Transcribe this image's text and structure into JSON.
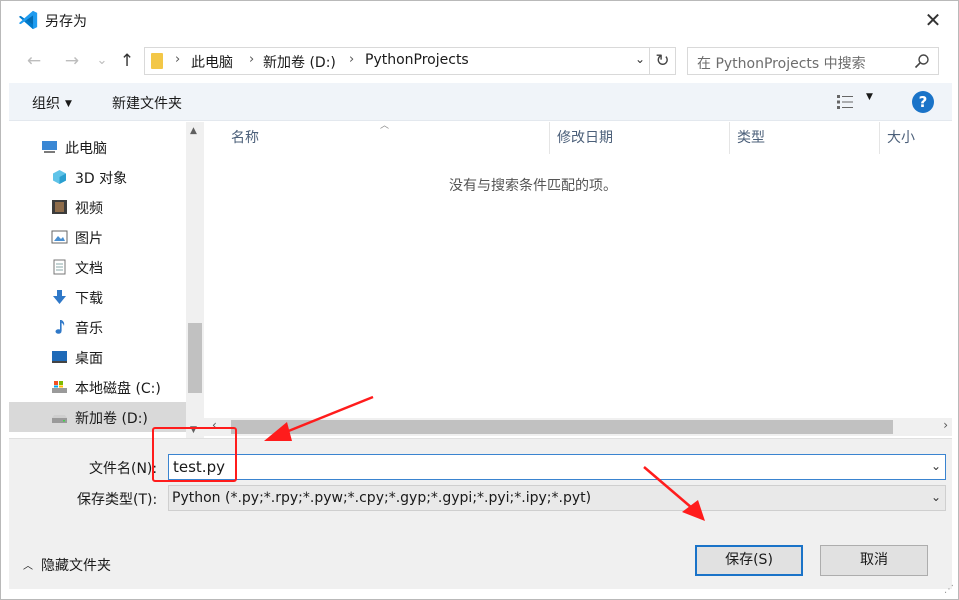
{
  "window": {
    "title": "另存为",
    "close_glyph": "✕"
  },
  "navigation": {
    "back_glyph": "←",
    "forward_glyph": "→",
    "recent_glyph": "⌄",
    "up_glyph": "↑",
    "breadcrumb": [
      "此电脑",
      "新加卷 (D:)",
      "PythonProjects"
    ],
    "refresh_glyph": "↻",
    "search_placeholder": "在 PythonProjects 中搜索"
  },
  "toolbar": {
    "organize": "组织",
    "new_folder": "新建文件夹",
    "help": "?"
  },
  "nav_pane": {
    "items": [
      {
        "label": "此电脑",
        "icon": "computer-icon"
      },
      {
        "label": "3D 对象",
        "icon": "cube-3d-icon"
      },
      {
        "label": "视频",
        "icon": "video-icon"
      },
      {
        "label": "图片",
        "icon": "picture-icon"
      },
      {
        "label": "文档",
        "icon": "document-icon"
      },
      {
        "label": "下载",
        "icon": "download-icon"
      },
      {
        "label": "音乐",
        "icon": "music-icon"
      },
      {
        "label": "桌面",
        "icon": "desktop-icon"
      },
      {
        "label": "本地磁盘 (C:)",
        "icon": "drive-c-icon"
      },
      {
        "label": "新加卷 (D:)",
        "icon": "drive-d-icon",
        "selected": true
      }
    ]
  },
  "file_list": {
    "columns": [
      "名称",
      "修改日期",
      "类型",
      "大小"
    ],
    "empty_message": "没有与搜索条件匹配的项。"
  },
  "form": {
    "filename_label": "文件名(N):",
    "filename_value": "test.py",
    "filetype_label": "保存类型(T):",
    "filetype_value": "Python (*.py;*.rpy;*.pyw;*.cpy;*.gyp;*.gypi;*.pyi;*.ipy;*.pyt)",
    "hide_folders": "隐藏文件夹",
    "save_button": "保存(S)",
    "cancel_button": "取消"
  },
  "colors": {
    "accent": "#1a73c8",
    "annotation": "#ff1c1c",
    "folder": "#f3c747"
  }
}
